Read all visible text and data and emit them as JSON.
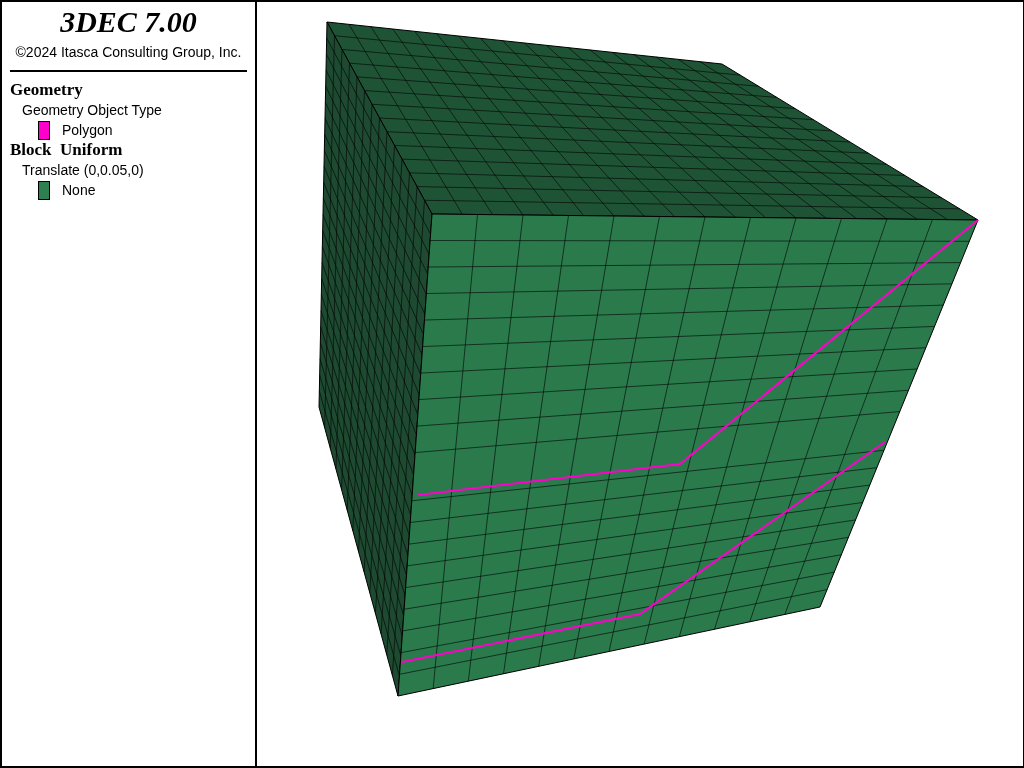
{
  "title": "3DEC 7.00",
  "copyright": "©2024 Itasca Consulting Group, Inc.",
  "legend": [
    {
      "heading": "Geometry",
      "subheading": "Geometry Object Type",
      "entries": [
        {
          "label": "Polygon",
          "color": "#ff00cc"
        }
      ]
    },
    {
      "heading": "Block  Uniform",
      "subheading": "Translate (0,0.05,0)",
      "entries": [
        {
          "label": "None",
          "color": "#2e8050"
        }
      ]
    }
  ]
}
